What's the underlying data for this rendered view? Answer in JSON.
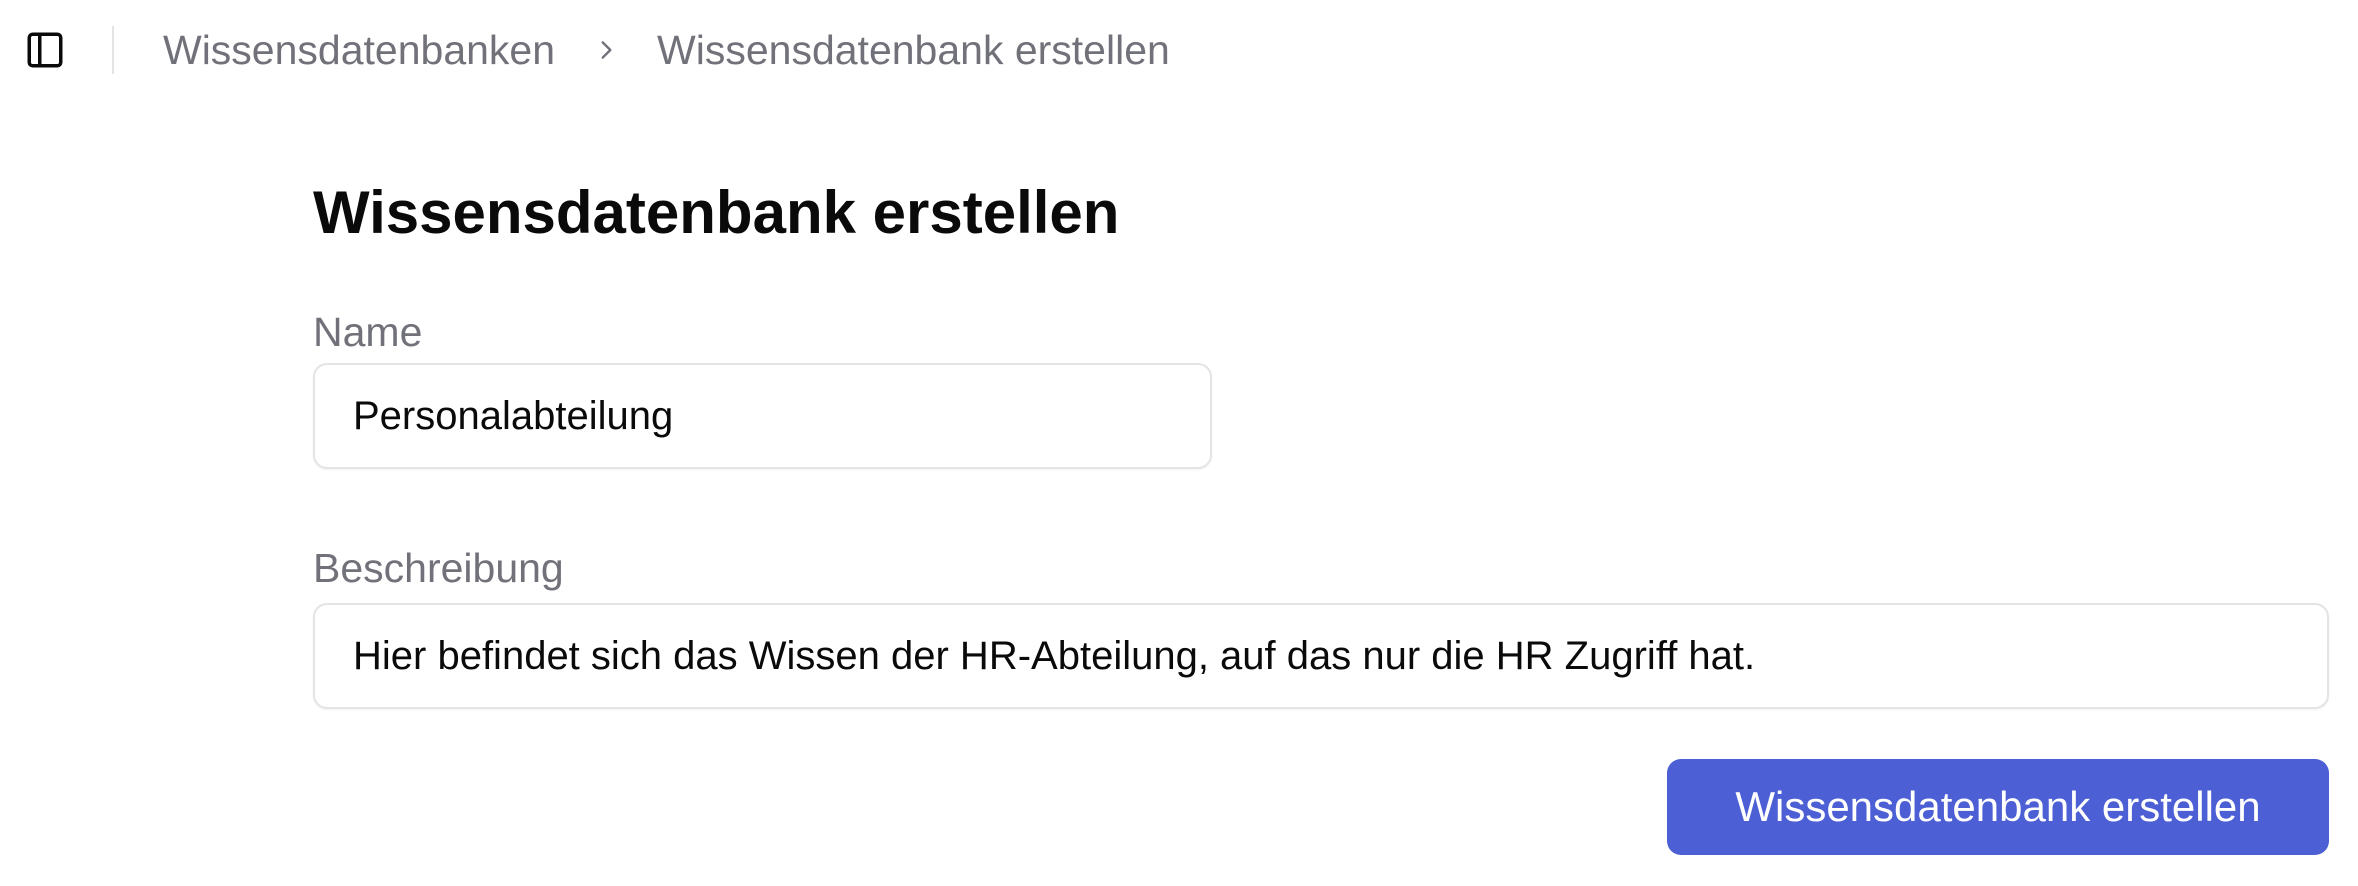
{
  "header": {
    "sidebar_toggle_icon": "panel-left-icon",
    "breadcrumb": {
      "items": [
        {
          "label": "Wissensdatenbanken"
        },
        {
          "label": "Wissensdatenbank erstellen"
        }
      ],
      "separator_icon": "chevron-right-icon"
    }
  },
  "main": {
    "title": "Wissensdatenbank erstellen",
    "form": {
      "name": {
        "label": "Name",
        "value": "Personalabteilung"
      },
      "description": {
        "label": "Beschreibung",
        "value": "Hier befindet sich das Wissen der HR-Abteilung, auf das nur die HR Zugriff hat."
      },
      "submit_label": "Wissensdatenbank erstellen"
    }
  },
  "colors": {
    "accent": "#4c5fd5",
    "muted_text": "#71717a",
    "border": "#e4e4e7",
    "text": "#0a0a0a"
  }
}
